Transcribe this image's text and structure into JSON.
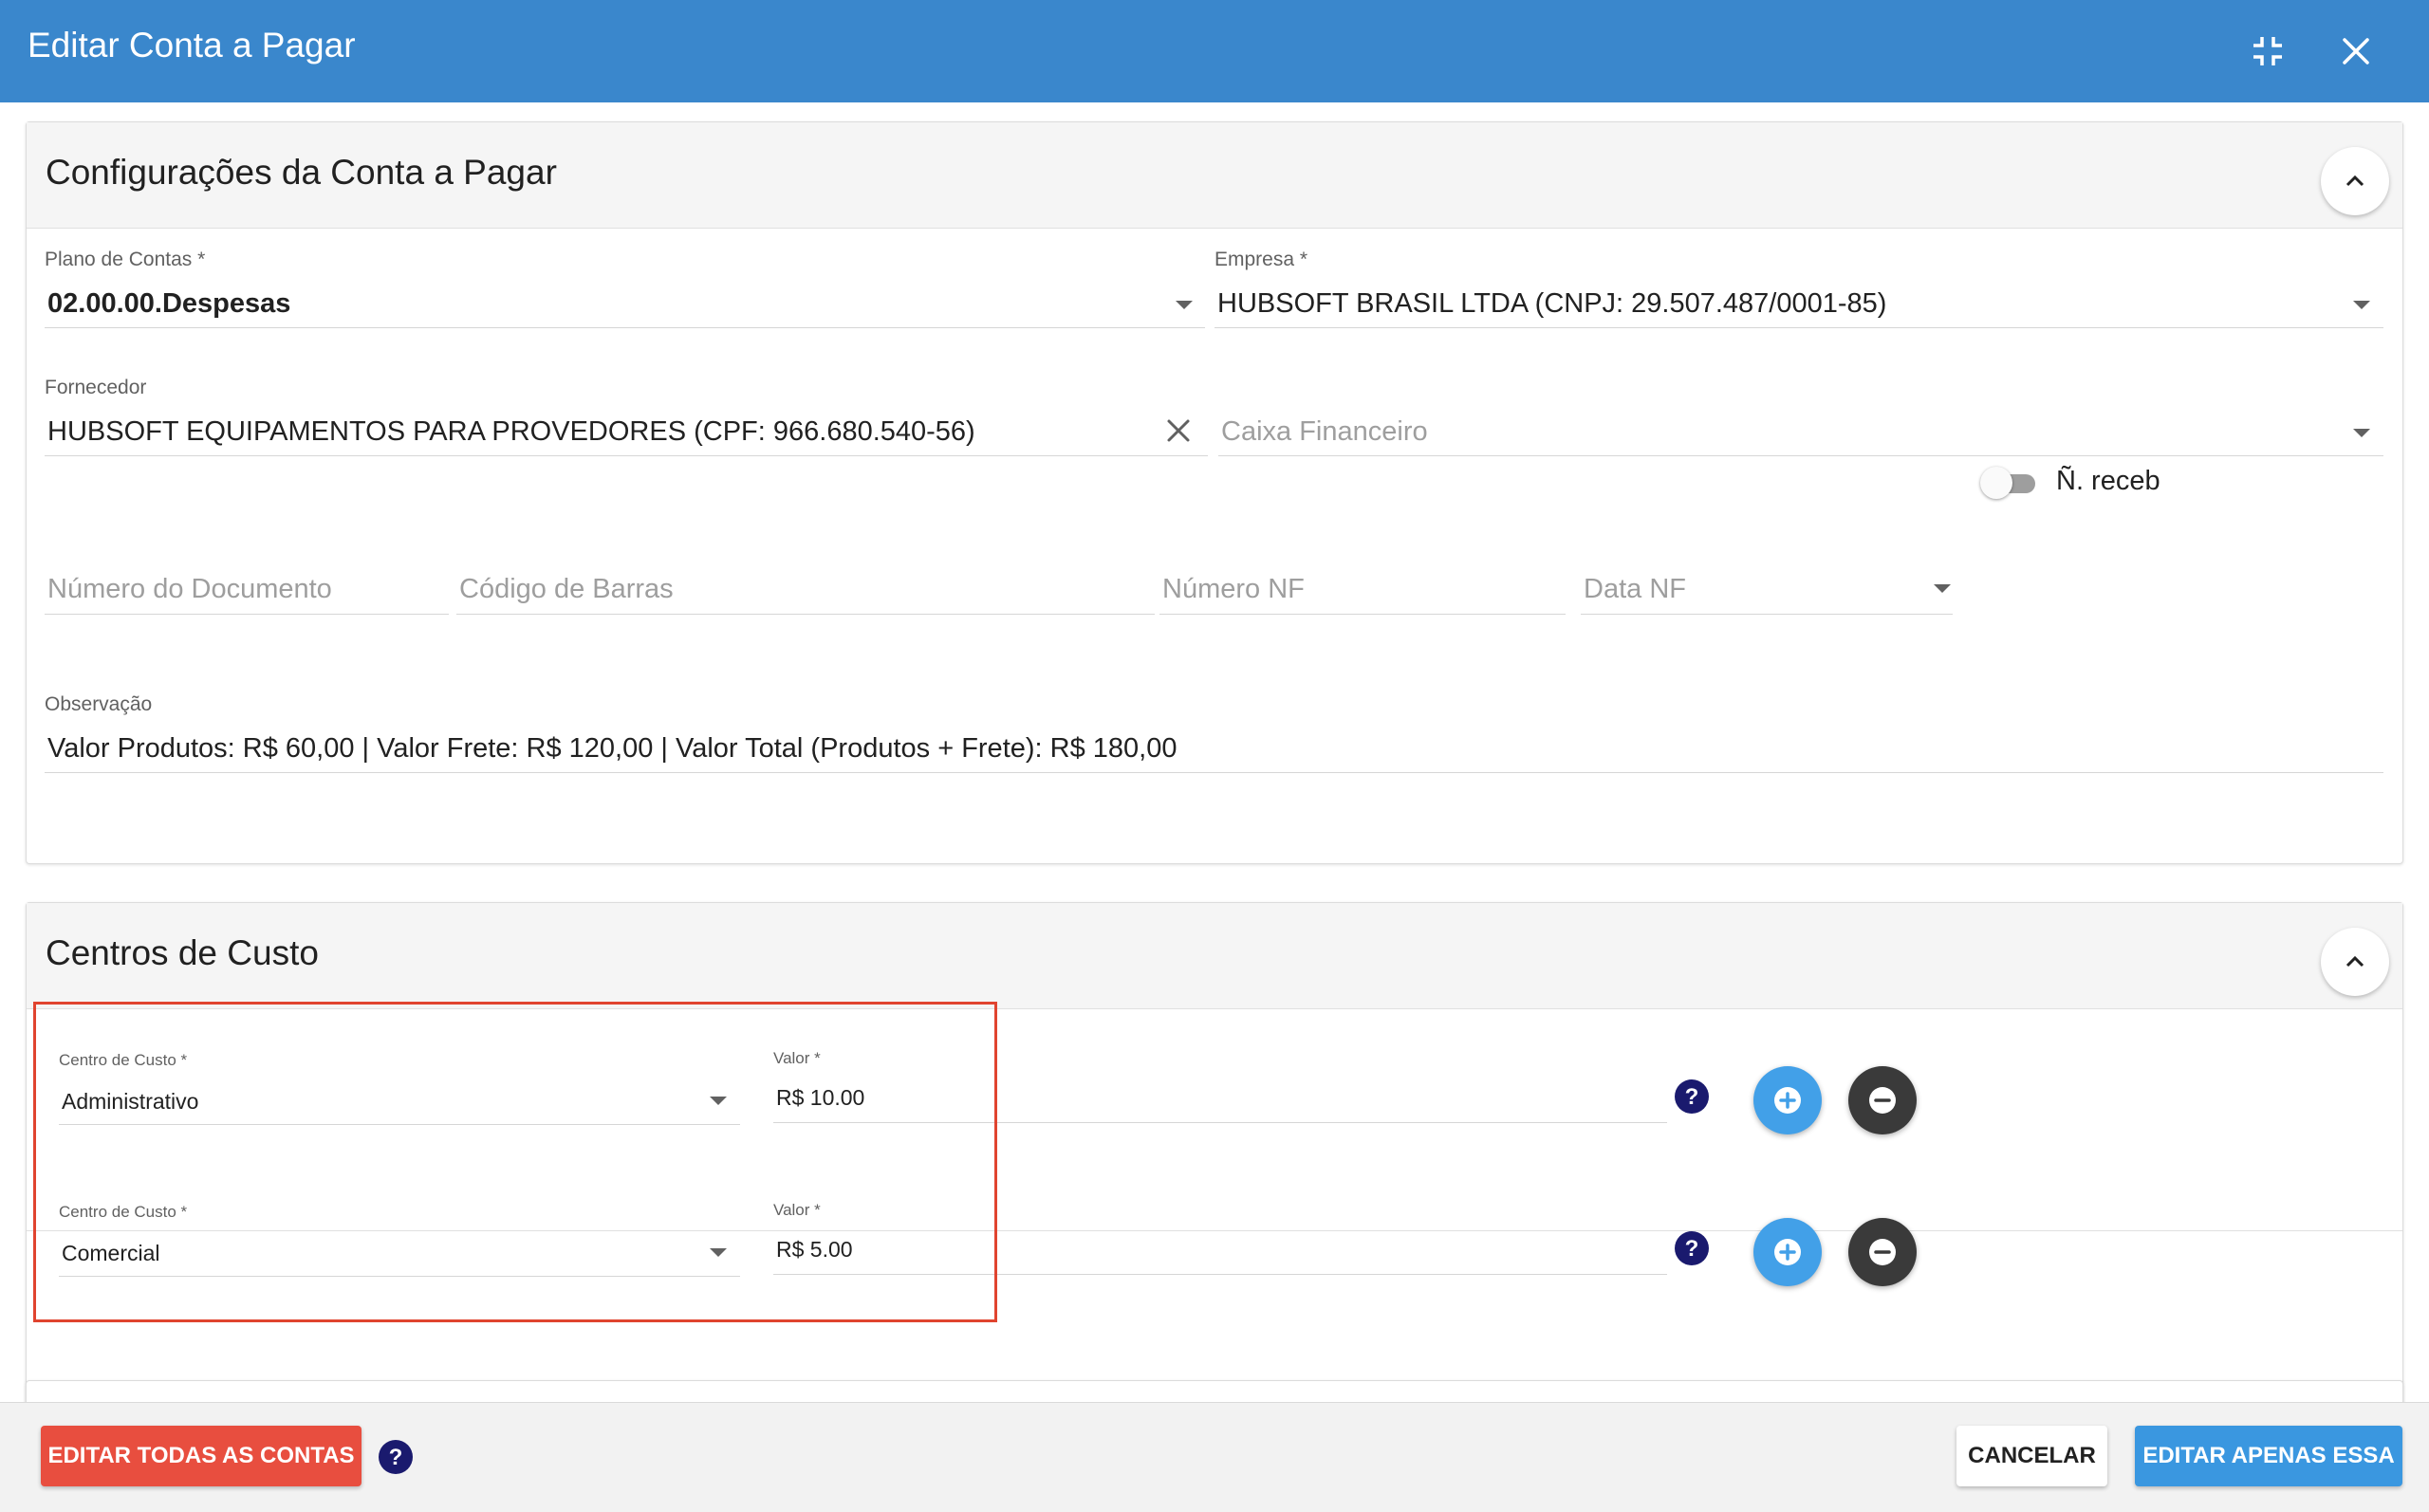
{
  "dialog": {
    "title": "Editar Conta a Pagar"
  },
  "icons": {
    "minimize": "compress-icon",
    "close": "close-icon",
    "collapse": "chevron-up-icon",
    "help": "help-circle-icon",
    "add": "plus-circle-icon",
    "remove": "minus-circle-icon",
    "clear": "clear-icon",
    "dropdown": "dropdown-arrow-icon"
  },
  "colors": {
    "header": "#3a87cc",
    "highlight_box": "#e0442f",
    "danger_button": "#e84e3f",
    "primary_button": "#3a97e0",
    "add_button": "#42a0e8",
    "remove_button": "#3a3a3a",
    "help_icon": "#1a1a6e"
  },
  "config": {
    "title": "Configurações da Conta a Pagar",
    "plano_de_contas": {
      "label": "Plano de Contas",
      "required": "*",
      "value": "02.00.00.Despesas"
    },
    "empresa": {
      "label": "Empresa",
      "required": "*",
      "value": "HUBSOFT BRASIL LTDA (CNPJ: 29.507.487/0001-85)"
    },
    "fornecedor": {
      "label": "Fornecedor",
      "value": "HUBSOFT EQUIPAMENTOS PARA PROVEDORES (CPF: 966.680.540-56)"
    },
    "caixa_financeiro": {
      "placeholder": "Caixa Financeiro"
    },
    "numero_documento": {
      "placeholder": "Número do Documento"
    },
    "codigo_barras": {
      "placeholder": "Código de Barras"
    },
    "numero_nf": {
      "placeholder": "Número NF"
    },
    "data_nf": {
      "placeholder": "Data NF"
    },
    "nao_receb": {
      "label": "Ñ. receb",
      "checked": false
    },
    "observacao": {
      "label": "Observação",
      "value": "Valor Produtos: R$ 60,00 | Valor Frete: R$ 120,00 | Valor Total (Produtos + Frete): R$ 180,00"
    }
  },
  "centros": {
    "title": "Centros de Custo",
    "rows": [
      {
        "centro_label": "Centro de Custo",
        "required": "*",
        "centro_value": "Administrativo",
        "valor_label": "Valor",
        "valor_value": "R$ 10.00"
      },
      {
        "centro_label": "Centro de Custo",
        "required": "*",
        "centro_value": "Comercial",
        "valor_label": "Valor",
        "valor_value": "R$ 5.00"
      }
    ]
  },
  "footer": {
    "edit_all": "EDITAR TODAS AS CONTAS",
    "cancel": "CANCELAR",
    "edit_only": "EDITAR APENAS ESSA"
  }
}
